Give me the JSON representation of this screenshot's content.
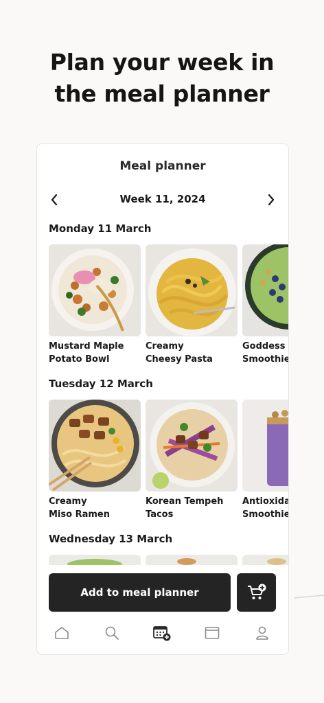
{
  "headline": {
    "line1": "Plan your week in",
    "line2": "the meal planner"
  },
  "card": {
    "title": "Meal planner",
    "week_label": "Week 11, 2024"
  },
  "days": [
    {
      "title": "Monday 11 March",
      "meals": [
        {
          "name": "Mustard Maple\nPotato Bowl",
          "image": "potato-bowl"
        },
        {
          "name": "Creamy\nCheesy Pasta",
          "image": "cheesy-pasta"
        },
        {
          "name": "Goddess\nSmoothie",
          "image": "green-smoothie"
        }
      ]
    },
    {
      "title": "Tuesday 12 March",
      "meals": [
        {
          "name": "Creamy\nMiso Ramen",
          "image": "miso-ramen"
        },
        {
          "name": "Korean Tempeh\nTacos",
          "image": "tempeh-tacos"
        },
        {
          "name": "Antioxidant\nSmoothie",
          "image": "purple-smoothie"
        }
      ]
    },
    {
      "title": "Wednesday 13 March",
      "meals": []
    }
  ],
  "actions": {
    "add_label": "Add to meal planner",
    "cart_icon": "cart-plus-icon"
  },
  "tabs": [
    "home-icon",
    "search-icon",
    "meal-planner-icon",
    "browser-icon",
    "profile-icon"
  ],
  "colors": {
    "primary": "#242424",
    "background": "#fbf8f8",
    "card": "#ffffff"
  }
}
